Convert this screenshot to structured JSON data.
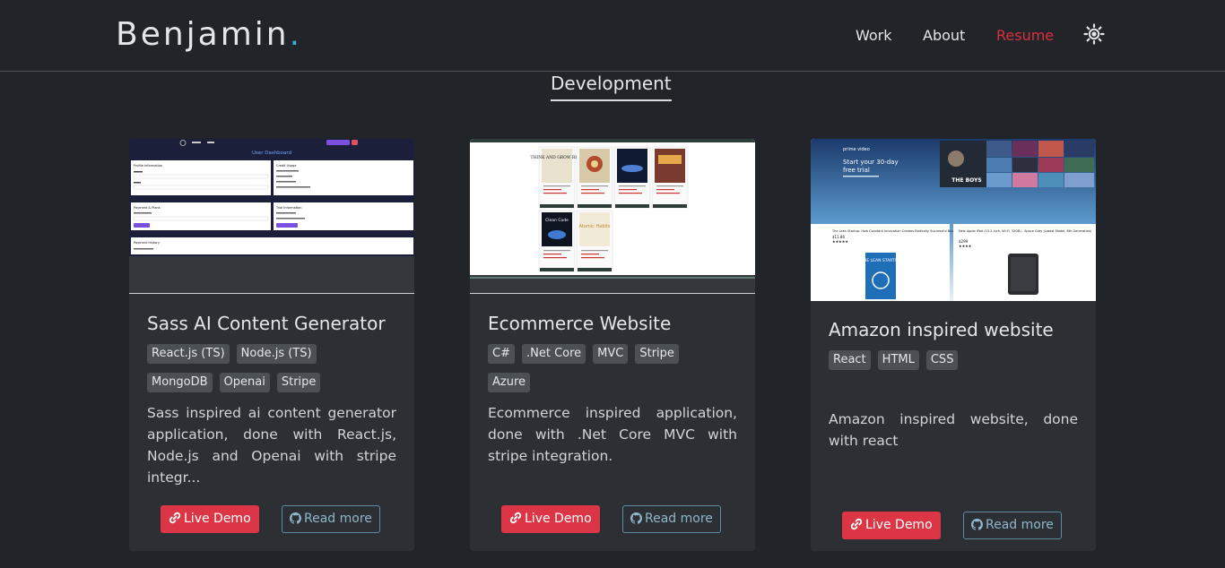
{
  "header": {
    "brand": "Benjamin",
    "brand_dot": ".",
    "nav": {
      "work": "Work",
      "about": "About",
      "resume": "Resume"
    },
    "theme_icon": "sun-icon"
  },
  "section": {
    "title": "Development"
  },
  "projects": [
    {
      "title": "Sass AI Content Generator",
      "tags": [
        "React.js (TS)",
        "Node.js (TS)",
        "MongoDB",
        "Openai",
        "Stripe"
      ],
      "description": "Sass inspired ai content generator application, done with React.js, Node.js and Openai with stripe integr...",
      "demo_label": "Live Demo",
      "read_label": "Read more",
      "thumb": {
        "header_title": "User Dashboard",
        "panel_profile": "Profile Information",
        "panel_credit": "Credit Usage",
        "panel_payment": "Payment & Plans",
        "panel_trial": "Trial Information",
        "panel_history": "Payment History"
      }
    },
    {
      "title": "Ecommerce Website",
      "tags": [
        "C#",
        ".Net Core",
        "MVC",
        "Stripe",
        "Azure"
      ],
      "description": "Ecommerce inspired application, done with .Net Core MVC with stripe integration.",
      "demo_label": "Live Demo",
      "read_label": "Read more",
      "thumb": {
        "book1": "THINK AND GROW RICH",
        "book5": "Clean Code",
        "book6": "Atomic Habits"
      }
    },
    {
      "title": "Amazon inspired website",
      "tags": [
        "React",
        "HTML",
        "CSS"
      ],
      "description": "Amazon inspired website, done with react",
      "demo_label": "Live Demo",
      "read_label": "Read more",
      "thumb": {
        "banner_brand": "prime video",
        "banner_line1": "Start your 30-day",
        "banner_line2": "free trial",
        "banner_show": "THE BOYS",
        "product1": "The Lean Startup: How Constant Innovation Creates Radically Successful Businesses",
        "product1_price": "$11.86",
        "product2": "New Apple iPad (10.2-inch, Wi-Fi, 32GB) - Space Gray (Latest Model, 8th Generation)",
        "product2_price": "$299",
        "product1_cover": "THE LEAN STARTUP"
      }
    }
  ],
  "colors": {
    "background": "#212529",
    "accent_blue": "#3fa9d7",
    "resume_red": "#dc2f3c",
    "demo_button": "#dc3545"
  }
}
